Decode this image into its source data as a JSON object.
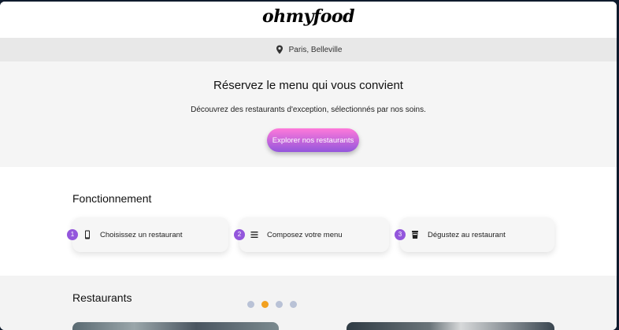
{
  "header": {
    "logo": "ohmyfood"
  },
  "location": {
    "text": "Paris, Belleville",
    "icon": "location-pin-icon"
  },
  "hero": {
    "title": "Réservez le menu qui vous convient",
    "subtitle": "Découvrez des restaurants d'exception, sélectionnés par nos soins.",
    "button_label": "Explorer nos restaurants"
  },
  "fonctionnement": {
    "title": "Fonctionnement",
    "steps": [
      {
        "number": "1",
        "icon": "mobile-phone-icon",
        "label": "Choisissez un restaurant"
      },
      {
        "number": "2",
        "icon": "list-icon",
        "label": "Composez votre menu"
      },
      {
        "number": "3",
        "icon": "cup-icon",
        "label": "Dégustez au restaurant"
      }
    ]
  },
  "restaurants": {
    "title": "Restaurants",
    "carousel_active_index": 2,
    "carousel_count": 4
  },
  "colors": {
    "accent_start": "#ff79da",
    "accent_end": "#9356dc",
    "active_dot": "#f2a120",
    "inactive_dot": "#b9c2d6"
  }
}
